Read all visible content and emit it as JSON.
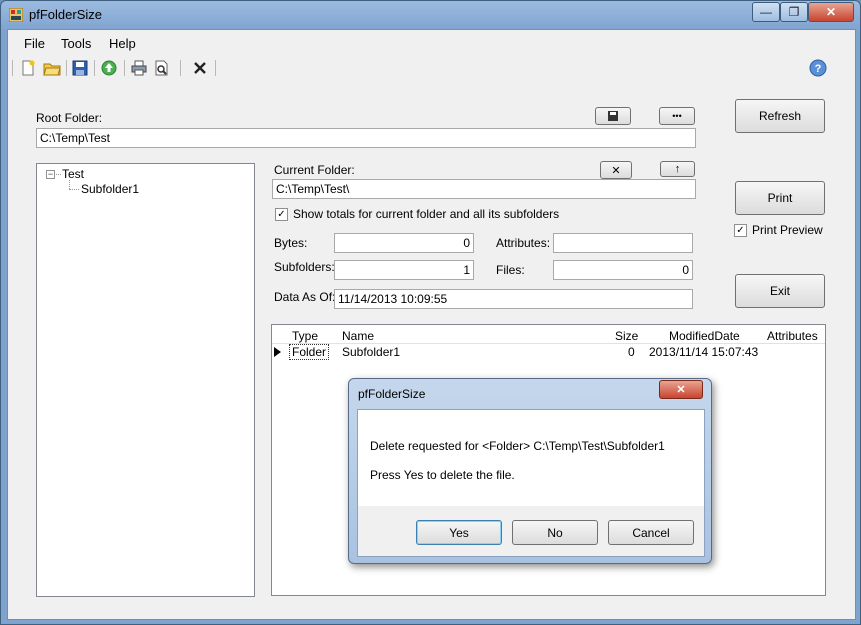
{
  "window": {
    "title": "pfFolderSize"
  },
  "menu": [
    "File",
    "Tools",
    "Help"
  ],
  "toolbar_icons": [
    "new-icon",
    "open-folder-icon",
    "save-icon",
    "up-icon",
    "print-icon",
    "print-preview-icon",
    "delete-icon",
    "help-icon"
  ],
  "root": {
    "label": "Root Folder:",
    "value": "C:\\Temp\\Test",
    "dots_label": "•••"
  },
  "tree": {
    "root": "Test",
    "child": "Subfolder1"
  },
  "current": {
    "label": "Current Folder:",
    "value": "C:\\Temp\\Test\\",
    "show_totals_label": "Show totals for current folder and all its subfolders",
    "show_totals_checked": true,
    "close_glyph": "✕",
    "up_glyph": "↑"
  },
  "stats": {
    "bytes_label": "Bytes:",
    "bytes": "0",
    "attributes_label": "Attributes:",
    "attributes": "",
    "subfolders_label": "Subfolders:",
    "subfolders": "1",
    "files_label": "Files:",
    "files": "0",
    "data_as_of_label": "Data As Of:",
    "data_as_of": "11/14/2013 10:09:55"
  },
  "buttons": {
    "refresh": "Refresh",
    "print": "Print",
    "print_preview": "Print Preview",
    "exit": "Exit"
  },
  "list": {
    "columns": [
      "Type",
      "Name",
      "Size",
      "ModifiedDate",
      "Attributes"
    ],
    "rows": [
      {
        "type": "Folder",
        "name": "Subfolder1",
        "size": "0",
        "modified": "2013/11/14 15:07:43",
        "attributes": ""
      }
    ]
  },
  "dialog": {
    "title": "pfFolderSize",
    "message1": "Delete requested for <Folder> C:\\Temp\\Test\\Subfolder1",
    "message2": "Press Yes to delete the file.",
    "yes": "Yes",
    "no": "No",
    "cancel": "Cancel",
    "close_glyph": "✕"
  },
  "caption": {
    "minimize": "—",
    "restore": "❐",
    "close": "✕"
  }
}
